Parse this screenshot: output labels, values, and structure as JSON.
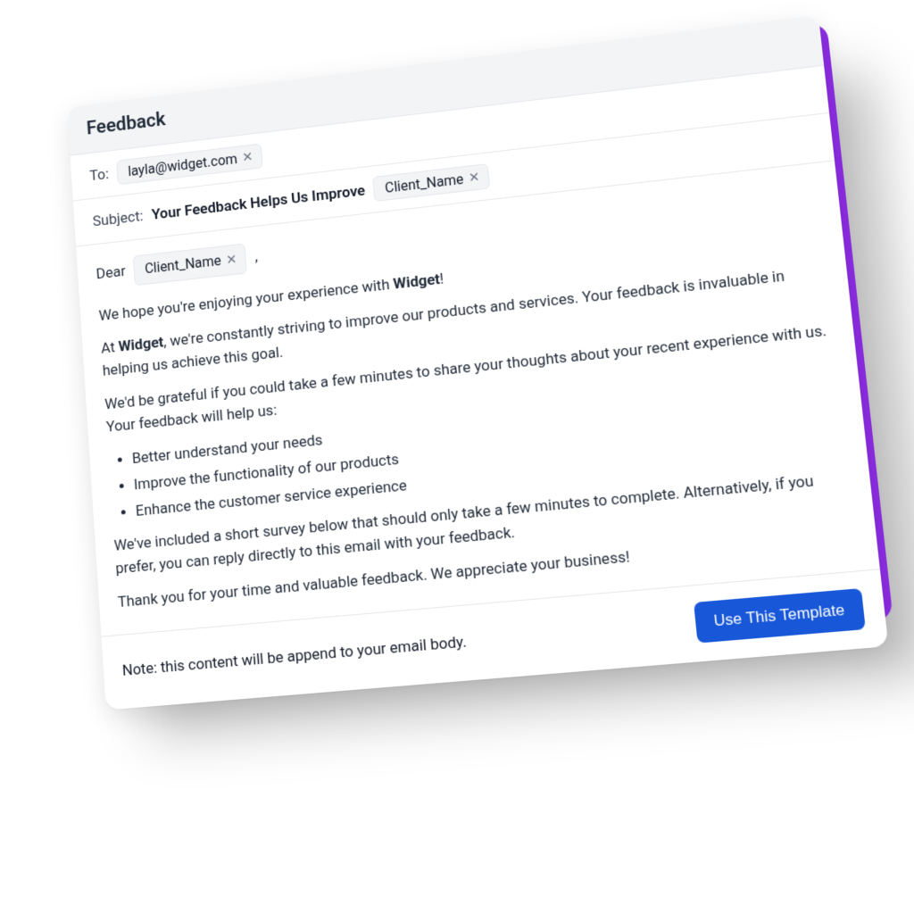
{
  "header": {
    "title": "Feedback"
  },
  "to": {
    "label": "To:",
    "chip": "layla@widget.com"
  },
  "subject": {
    "label": "Subject:",
    "text": "Your Feedback Helps Us Improve",
    "chip": "Client_Name"
  },
  "body": {
    "greeting_prefix": "Dear",
    "greeting_chip": "Client_Name",
    "greeting_suffix": ",",
    "intro_pre": "We hope you're enjoying your experience with ",
    "intro_bold": "Widget",
    "intro_post": "!",
    "p2_pre": "At ",
    "p2_bold": "Widget",
    "p2_post": ", we're constantly striving to improve our products and services. Your feedback is invaluable in helping us achieve this goal.",
    "p3": "We'd be grateful if you could take a few minutes to share your thoughts about your recent experience with us. Your feedback will help us:",
    "bullets": [
      "Better understand your needs",
      "Improve the functionality of our products",
      "Enhance the customer service experience"
    ],
    "p4": "We've included a short survey below that should only take a few minutes to complete.  Alternatively, if you prefer, you can reply directly to this email with your feedback.",
    "p5": "Thank you for your time and valuable feedback. We appreciate your business!"
  },
  "footer": {
    "note": "Note: this content will be append to your email body.",
    "button": "Use This Template"
  }
}
